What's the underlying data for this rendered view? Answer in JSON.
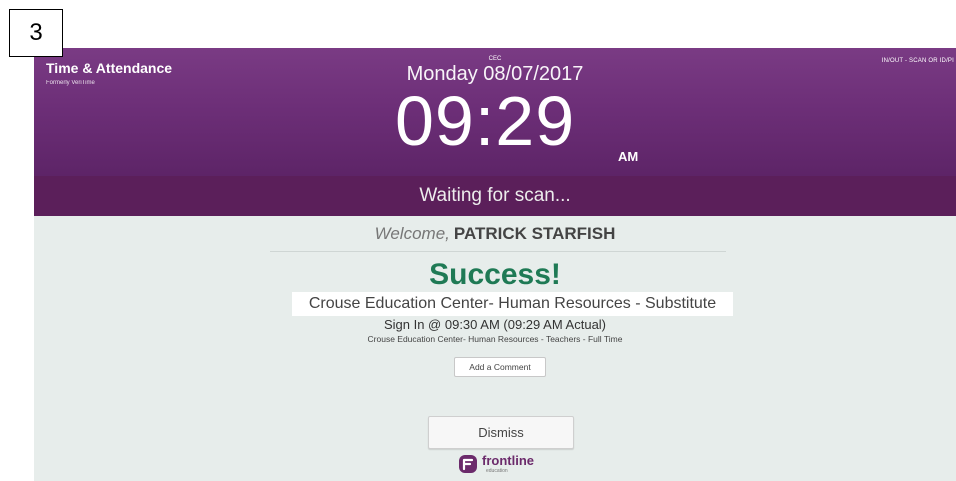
{
  "step_marker": "3",
  "header": {
    "brand_title": "Time & Attendance",
    "brand_subtitle": "Formerly VeriTime",
    "location": "CEC",
    "date": "Monday 08/07/2017",
    "time": "09:29",
    "ampm": "AM",
    "top_right_label": "IN/OUT - SCAN OR ID/PI"
  },
  "status": {
    "text": "Waiting for scan..."
  },
  "main": {
    "welcome_prefix": "Welcome,",
    "user_name": "PATRICK STARFISH",
    "success_text": "Success!",
    "job_line": "Crouse Education Center- Human Resources - Substitute",
    "signin_text": "Sign In @ 09:30 AM (09:29 AM Actual)",
    "primary_job": "Crouse Education Center- Human Resources - Teachers - Full Time",
    "add_comment_label": "Add a Comment",
    "dismiss_label": "Dismiss"
  },
  "footer": {
    "logo_text": "frontline",
    "logo_sub": "education",
    "logo_icon": "frontline-logo-icon"
  },
  "colors": {
    "header_purple": "#6d2f78",
    "status_bar": "#5b1f5a",
    "success_green": "#1f7a55",
    "background": "#e7edeb"
  }
}
